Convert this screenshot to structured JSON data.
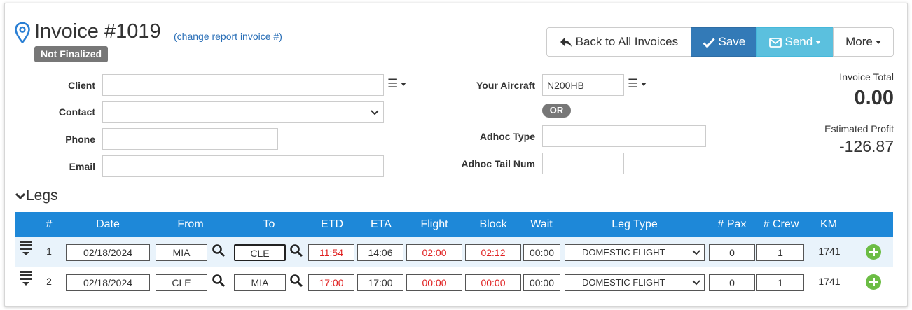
{
  "header": {
    "title": "Invoice #1019",
    "change_link": "(change report invoice #)",
    "status_badge": "Not Finalized"
  },
  "toolbar": {
    "back_label": "Back to All Invoices",
    "save_label": "Save",
    "send_label": "Send",
    "more_label": "More"
  },
  "form": {
    "client_label": "Client",
    "client_value": "",
    "contact_label": "Contact",
    "contact_value": "",
    "phone_label": "Phone",
    "phone_value": "",
    "email_label": "Email",
    "email_value": "",
    "aircraft_label": "Your Aircraft",
    "aircraft_value": "N200HB",
    "or_label": "OR",
    "adhoc_type_label": "Adhoc Type",
    "adhoc_type_value": "",
    "adhoc_tail_label": "Adhoc Tail Num",
    "adhoc_tail_value": ""
  },
  "totals": {
    "invoice_total_label": "Invoice Total",
    "invoice_total_value": "0.00",
    "profit_label": "Estimated Profit",
    "profit_value": "-126.87"
  },
  "legs": {
    "heading": "Legs",
    "columns": [
      "#",
      "Date",
      "From",
      "To",
      "ETD",
      "ETA",
      "Flight",
      "Block",
      "Wait",
      "Leg Type",
      "# Pax",
      "# Crew",
      "KM"
    ],
    "rows": [
      {
        "num": "1",
        "date": "02/18/2024",
        "from": "MIA",
        "to": "CLE",
        "etd": "11:54",
        "eta": "14:06",
        "flight": "02:00",
        "block": "02:12",
        "wait": "00:00",
        "leg_type": "DOMESTIC FLIGHT",
        "pax": "0",
        "crew": "1",
        "km": "1741"
      },
      {
        "num": "2",
        "date": "02/18/2024",
        "from": "CLE",
        "to": "MIA",
        "etd": "17:00",
        "eta": "17:00",
        "flight": "00:00",
        "block": "00:00",
        "wait": "00:00",
        "leg_type": "DOMESTIC FLIGHT",
        "pax": "0",
        "crew": "1",
        "km": "1741"
      }
    ]
  },
  "colors": {
    "primary": "#337ab7",
    "info": "#5bc0de",
    "table_header": "#1e88d8",
    "add": "#6cbd45",
    "red_time": "#e02020"
  },
  "icons": [
    "map-marker-icon",
    "reply-arrow-icon",
    "check-icon",
    "envelope-icon",
    "list-icon",
    "chevron-down-icon",
    "search-icon",
    "plus-circle-icon",
    "drag-handle-icon"
  ]
}
